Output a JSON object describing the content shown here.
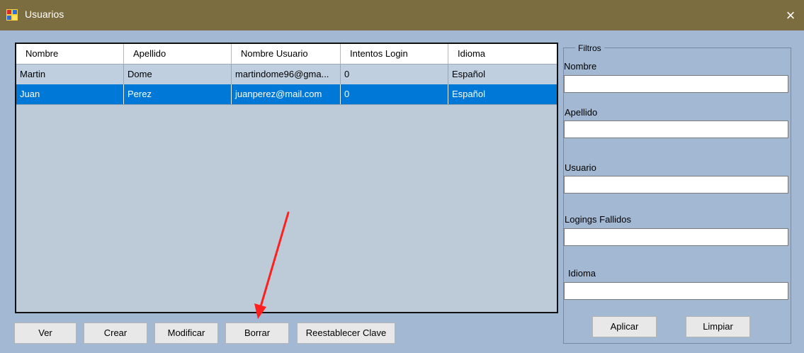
{
  "window": {
    "title": "Usuarios",
    "close_glyph": "×"
  },
  "grid": {
    "columns": [
      "Nombre",
      "Apellido",
      "Nombre Usuario",
      "Intentos Login",
      "Idioma"
    ],
    "rows": [
      {
        "nombre": "Martin",
        "apellido": "Dome",
        "usuario": "martindome96@gma...",
        "intentos": "0",
        "idioma": "Español",
        "selected": false
      },
      {
        "nombre": "Juan",
        "apellido": "Perez",
        "usuario": "juanperez@mail.com",
        "intentos": "0",
        "idioma": "Español",
        "selected": true
      }
    ]
  },
  "buttons": {
    "ver": "Ver",
    "crear": "Crear",
    "modificar": "Modificar",
    "borrar": "Borrar",
    "reestablecer": "Reestablecer Clave"
  },
  "filters": {
    "title": "Filtros",
    "nombre_label": "Nombre",
    "apellido_label": "Apellido",
    "usuario_label": "Usuario",
    "logings_label": "Logings Fallidos",
    "idioma_label": "Idioma",
    "nombre_value": "",
    "apellido_value": "",
    "usuario_value": "",
    "logings_value": "",
    "idioma_value": "",
    "aplicar": "Aplicar",
    "limpiar": "Limpiar"
  },
  "colors": {
    "title_bar": "#7c6d40",
    "window_bg": "#a3b8d2",
    "selected_row": "#0078d7",
    "annotation_arrow": "#ff1f1f"
  }
}
